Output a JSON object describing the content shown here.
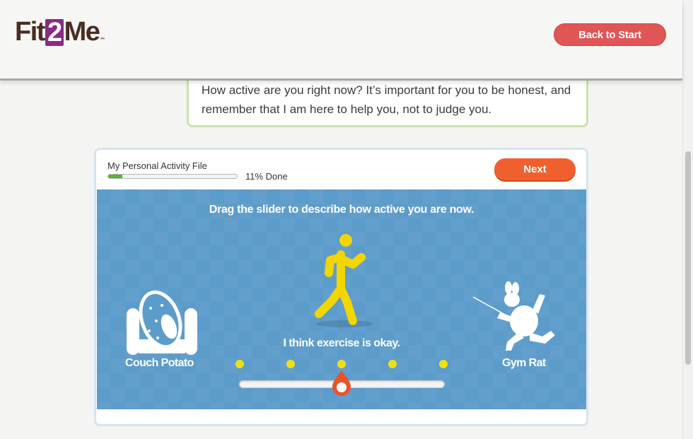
{
  "header": {
    "logo": {
      "part1": "Fit",
      "part2": "2",
      "part3": "Me",
      "tm": "™"
    },
    "back_button": "Back to Start"
  },
  "bubble": {
    "text": "How active are you right now? It’s important for you to be honest, and remember that I am here to help you, not to judge you."
  },
  "panel": {
    "file_title": "My Personal Activity File",
    "progress_percent": 11,
    "progress_text": "11% Done",
    "next_button": "Next"
  },
  "stage": {
    "instruction": "Drag the slider to describe how active you are now.",
    "status_text": "I think exercise is okay.",
    "left_label": "Couch Potato",
    "right_label": "Gym Rat",
    "slider_steps": 5,
    "slider_selected_step": 3
  },
  "colors": {
    "logo_brown": "#4a2d22",
    "logo_purple": "#8a2a86",
    "back_button": "#e05555",
    "next_button": "#f0602f",
    "stage_blue": "#5c9ccb",
    "accent_yellow": "#f3df10",
    "progress_green": "#5ab03a",
    "bubble_border": "#c9e4a7"
  },
  "icons": [
    "runner-icon",
    "couch-potato-icon",
    "gym-rat-icon",
    "slider-handle-icon"
  ]
}
